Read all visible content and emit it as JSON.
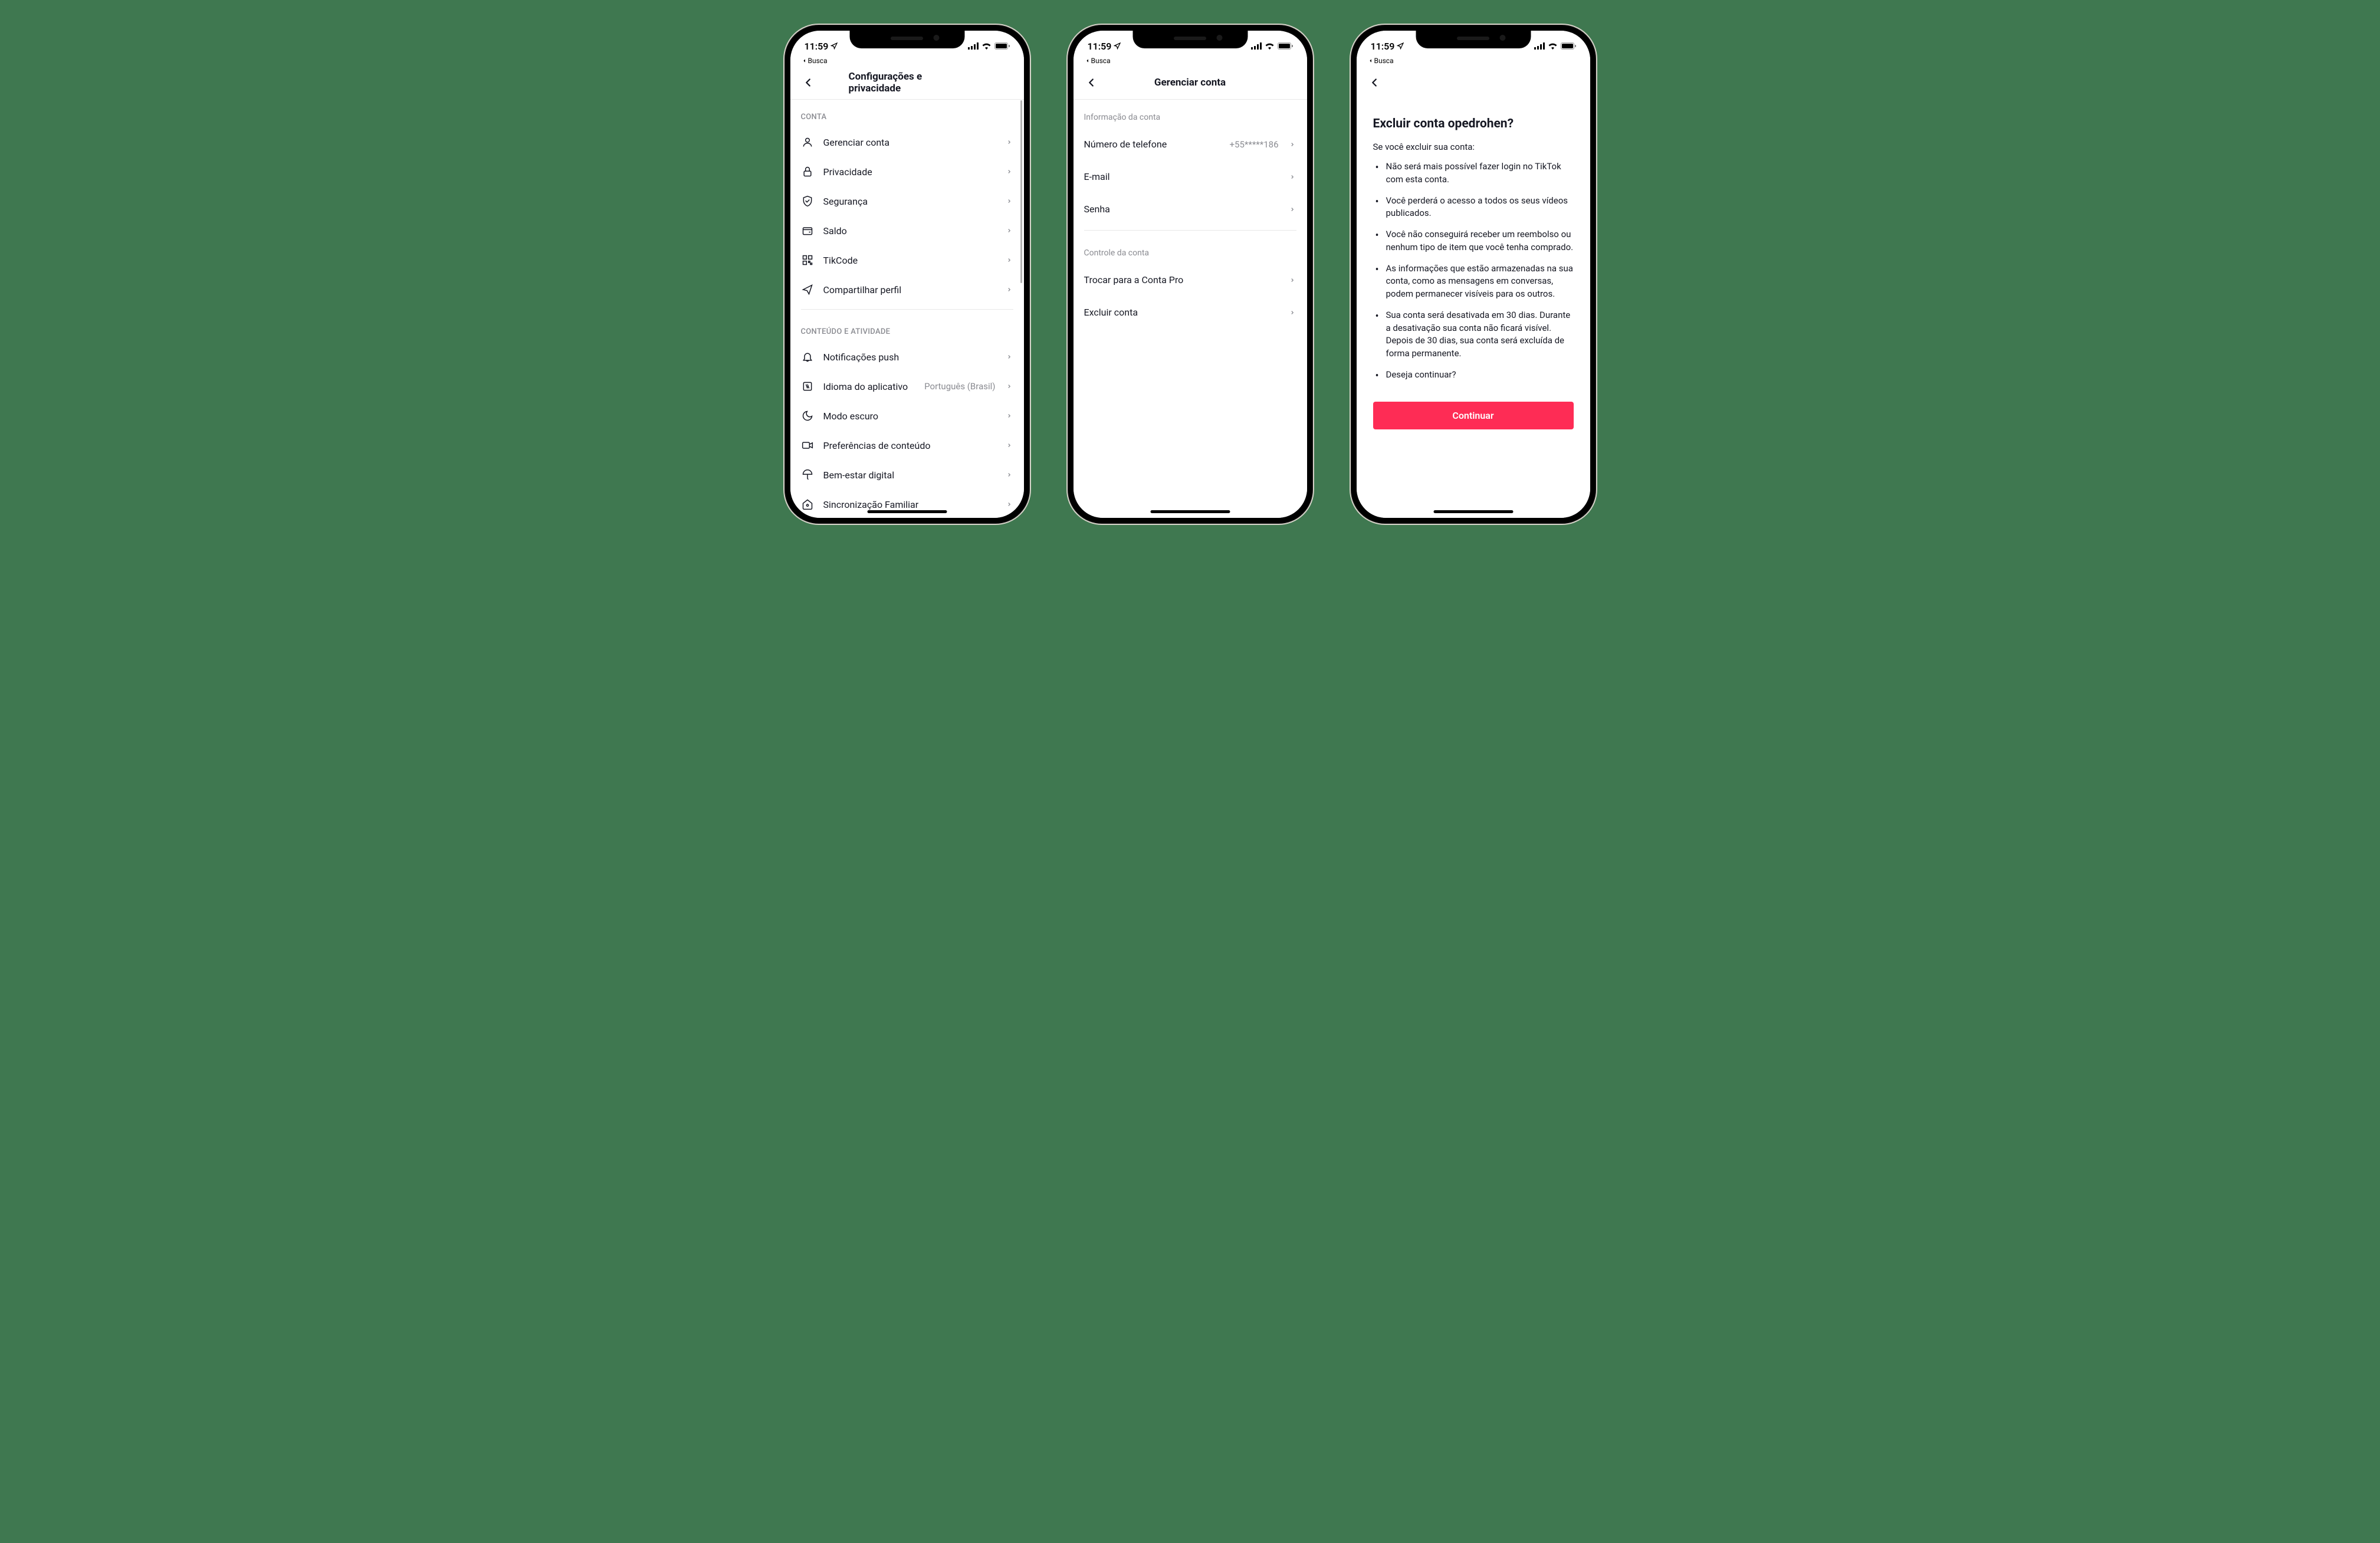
{
  "status": {
    "time": "11:59",
    "breadcrumb_back": "Busca"
  },
  "screen1": {
    "title": "Configurações e privacidade",
    "section_conta": "CONTA",
    "section_conteudo": "CONTEÚDO E ATIVIDADE",
    "items_conta": {
      "gerenciar": "Gerenciar conta",
      "privacidade": "Privacidade",
      "seguranca": "Segurança",
      "saldo": "Saldo",
      "tikcode": "TikCode",
      "compartilhar": "Compartilhar perfil"
    },
    "items_conteudo": {
      "notificacoes": "Notificações push",
      "idioma": "Idioma do aplicativo",
      "idioma_value": "Português (Brasil)",
      "modo_escuro": "Modo escuro",
      "preferencias": "Preferências de conteúdo",
      "bemestar": "Bem-estar digital",
      "sincronizacao": "Sincronização Familiar"
    }
  },
  "screen2": {
    "title": "Gerenciar conta",
    "section_info": "Informação da conta",
    "section_controle": "Controle da conta",
    "items": {
      "telefone": "Número de telefone",
      "telefone_value": "+55*****186",
      "email": "E-mail",
      "senha": "Senha",
      "trocar_pro": "Trocar para a Conta Pro",
      "excluir": "Excluir conta"
    }
  },
  "screen3": {
    "title": "Excluir conta opedrohen?",
    "subtitle": "Se você excluir sua conta:",
    "bullets": {
      "b1": "Não será mais possível fazer login no TikTok com esta conta.",
      "b2": "Você perderá o acesso a todos os seus vídeos publicados.",
      "b3": "Você não conseguirá receber um reembolso ou nenhum tipo de item que você tenha comprado.",
      "b4": "As informações que estão armazenadas na sua conta, como as mensagens em conversas, podem permanecer visíveis para os outros.",
      "b5": "Sua conta será desativada em 30 dias. Durante a desativação sua conta não ficará visível. Depois de 30 dias, sua conta será excluída de forma permanente.",
      "b6": "Deseja continuar?"
    },
    "continue_button": "Continuar"
  }
}
